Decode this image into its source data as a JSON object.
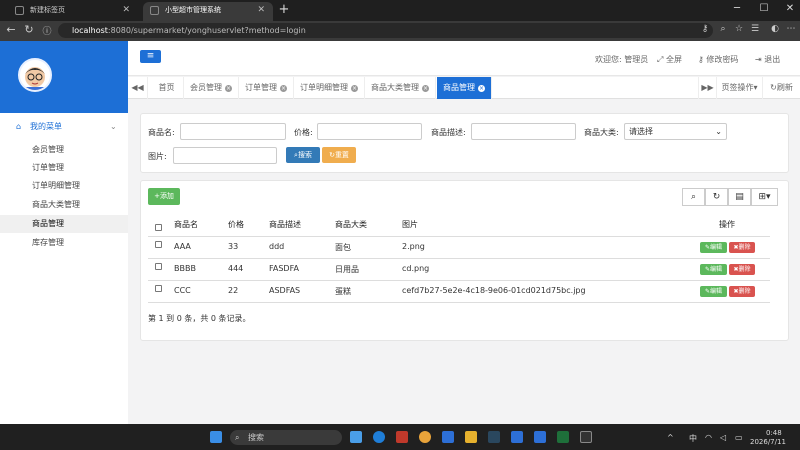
{
  "browser": {
    "tabs": [
      {
        "title": "新建标签页"
      },
      {
        "title": "小型超市管理系统"
      }
    ],
    "url_host": "localhost",
    "url_rest": ":8080/supermarket/yonghuservlet?method=login"
  },
  "header": {
    "welcome": "欢迎您: 管理员",
    "fullscreen": "全屏",
    "change_password": "修改密码",
    "logout": "退出"
  },
  "sidebar": {
    "menu_title": "我的菜单",
    "items": [
      {
        "label": "会员管理"
      },
      {
        "label": "订单管理"
      },
      {
        "label": "订单明细管理"
      },
      {
        "label": "商品大类管理"
      },
      {
        "label": "商品管理"
      },
      {
        "label": "库存管理"
      }
    ]
  },
  "page_tabs": {
    "items": [
      {
        "label": "首页"
      },
      {
        "label": "会员管理"
      },
      {
        "label": "订单管理"
      },
      {
        "label": "订单明细管理"
      },
      {
        "label": "商品大类管理"
      },
      {
        "label": "商品管理"
      }
    ],
    "tab_ops": "页签操作",
    "refresh": "刷新"
  },
  "search": {
    "name_label": "商品名:",
    "price_label": "价格:",
    "desc_label": "商品描述:",
    "category_label": "商品大类:",
    "category_value": "请选择",
    "image_label": "图片:",
    "search_btn": "搜索",
    "reset_btn": "重置"
  },
  "table": {
    "add_btn": "添加",
    "columns": [
      "商品名",
      "价格",
      "商品描述",
      "商品大类",
      "图片",
      "操作"
    ],
    "rows": [
      {
        "name": "AAA",
        "price": "33",
        "desc": "ddd",
        "category": "面包",
        "image": "2.png"
      },
      {
        "name": "BBBB",
        "price": "444",
        "desc": "FASDFA",
        "category": "日用品",
        "image": "cd.png"
      },
      {
        "name": "CCC",
        "price": "22",
        "desc": "ASDFAS",
        "category": "蛋糕",
        "image": "cefd7b27-5e2e-4c18-9e06-01cd021d75bc.jpg"
      }
    ],
    "edit_label": "编辑",
    "delete_label": "删除",
    "footer": "第 1 到 0 条，共 0 条记录。"
  },
  "taskbar": {
    "search": "搜索",
    "ime": "中",
    "time": "0:48",
    "date": "2026/7/11"
  },
  "colors": {
    "primary": "#1d6fd6",
    "success": "#5cb85c",
    "danger": "#d9534f",
    "warning": "#f0ad4e"
  }
}
